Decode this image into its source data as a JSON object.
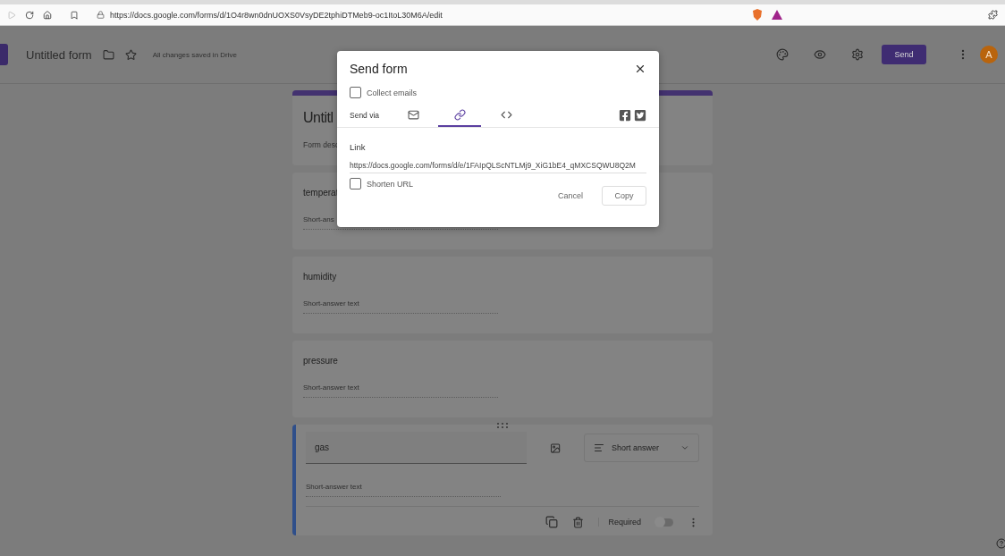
{
  "browser": {
    "url": "https://docs.google.com/forms/d/1O4r8wn0dnUOXS0VsyDE2tphiDTMeb9-oc1ItoL30M6A/edit"
  },
  "header": {
    "title": "Untitled form",
    "save_status": "All changes saved in Drive",
    "send_label": "Send",
    "avatar": "A"
  },
  "form": {
    "title": "Untitl",
    "description": "Form desc"
  },
  "questions": [
    {
      "title": "temperat",
      "answer": "Short-ans",
      "editing": false
    },
    {
      "title": "humidity",
      "answer": "Short-answer text",
      "editing": false
    },
    {
      "title": "pressure",
      "answer": "Short-answer text",
      "editing": false
    },
    {
      "title": "gas",
      "answer": "Short-answer text",
      "editing": true,
      "type": "Short answer",
      "required_label": "Required",
      "required": false
    }
  ],
  "dialog": {
    "title": "Send form",
    "collect_emails": {
      "label": "Collect emails",
      "checked": false
    },
    "send_via": "Send via",
    "tabs": [
      {
        "kind": "email",
        "selected": false
      },
      {
        "kind": "link",
        "selected": true
      },
      {
        "kind": "embed",
        "selected": false
      }
    ],
    "link_label": "Link",
    "link": "https://docs.google.com/forms/d/e/1FAIpQLScNTLMj9_XiG1bE4_qMXCSQWU8Q2M",
    "shorten": {
      "label": "Shorten URL",
      "checked": false
    },
    "cancel": "Cancel",
    "copy": "Copy"
  }
}
